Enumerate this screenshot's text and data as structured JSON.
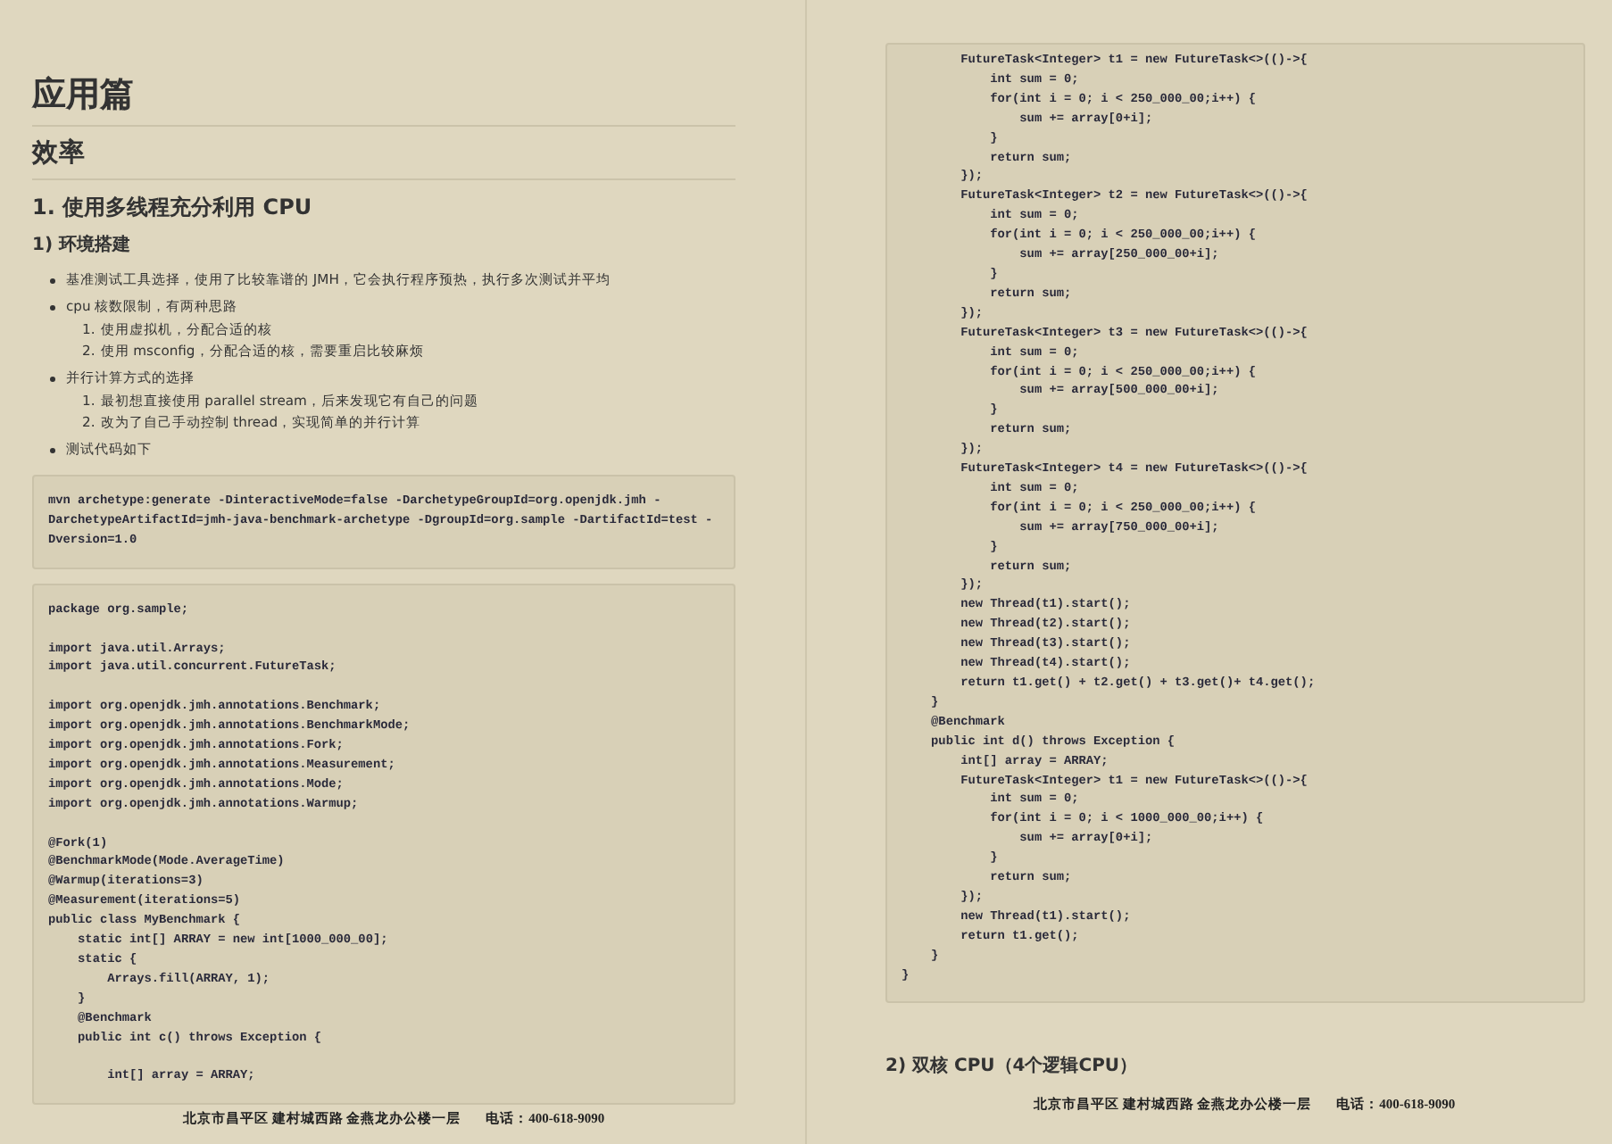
{
  "pages": [
    {
      "blocks": [
        {
          "kind": "h1",
          "text": "应用篇"
        },
        {
          "kind": "h2",
          "text": "效率"
        },
        {
          "kind": "h3",
          "text": "1. 使用多线程充分利用 CPU"
        },
        {
          "kind": "h4",
          "text": "1) 环境搭建"
        },
        {
          "kind": "bullets",
          "items": [
            {
              "text": "基准测试工具选择，使用了比较靠谱的 JMH，它会执行程序预热，执行多次测试并平均"
            },
            {
              "text": "cpu 核数限制，有两种思路",
              "children": [
                {
                  "number": "1.",
                  "text": "使用虚拟机，分配合适的核"
                },
                {
                  "number": "2.",
                  "text": "使用 msconfig，分配合适的核，需要重启比较麻烦"
                }
              ]
            },
            {
              "text": "并行计算方式的选择",
              "children": [
                {
                  "number": "1.",
                  "text": "最初想直接使用 parallel stream，后来发现它有自己的问题"
                },
                {
                  "number": "2.",
                  "text": "改为了自己手动控制 thread，实现简单的并行计算"
                }
              ]
            },
            {
              "text": "测试代码如下"
            }
          ]
        },
        {
          "kind": "code",
          "lines": [
            {
              "text": "mvn archetype:generate -DinteractiveMode=false -DarchetypeGroupId=org.openjdk.jmh -DarchetypeArtifactId=jmh-java-benchmark-archetype -DgroupId=org.sample -DartifactId=test -Dversion=1.0"
            }
          ]
        },
        {
          "kind": "code",
          "lines": [
            {
              "text": "package org.sample;"
            },
            {
              "text": "import java.util.Arrays;",
              "blank_before": true
            },
            {
              "text": "import java.util.concurrent.FutureTask;"
            },
            {
              "text": "import org.openjdk.jmh.annotations.Benchmark;",
              "blank_before": true
            },
            {
              "text": "import org.openjdk.jmh.annotations.BenchmarkMode;"
            },
            {
              "text": "import org.openjdk.jmh.annotations.Fork;"
            },
            {
              "text": "import org.openjdk.jmh.annotations.Measurement;"
            },
            {
              "text": "import org.openjdk.jmh.annotations.Mode;"
            },
            {
              "text": "import org.openjdk.jmh.annotations.Warmup;"
            },
            {
              "text": "@Fork(1)",
              "blank_before": true
            },
            {
              "text": "@BenchmarkMode(Mode.AverageTime)"
            },
            {
              "text": "@Warmup(iterations=3)"
            },
            {
              "text": "@Measurement(iterations=5)"
            },
            {
              "text": "public class MyBenchmark {"
            },
            {
              "text": "    static int[] ARRAY = new int[1000_000_00];"
            },
            {
              "text": "    static {"
            },
            {
              "text": "        Arrays.fill(ARRAY, 1);"
            },
            {
              "text": "    }"
            },
            {
              "text": "    @Benchmark"
            },
            {
              "text": "    public int c() throws Exception {"
            },
            {
              "text": "        int[] array = ARRAY;",
              "blank_before": true
            }
          ]
        }
      ],
      "footer": {
        "address": "北京市昌平区 建村城西路 金燕龙办公楼一层",
        "phone": "电话：400-618-9090"
      }
    },
    {
      "blocks": [
        {
          "kind": "code",
          "lines": [
            {
              "text": "        FutureTask<Integer> t1 = new FutureTask<>(()->{"
            },
            {
              "text": "            int sum = 0;"
            },
            {
              "text": "            for(int i = 0; i < 250_000_00;i++) {"
            },
            {
              "text": "                sum += array[0+i];"
            },
            {
              "text": "            }"
            },
            {
              "text": "            return sum;"
            },
            {
              "text": "        });"
            },
            {
              "text": "        FutureTask<Integer> t2 = new FutureTask<>(()->{"
            },
            {
              "text": "            int sum = 0;"
            },
            {
              "text": "            for(int i = 0; i < 250_000_00;i++) {"
            },
            {
              "text": "                sum += array[250_000_00+i];"
            },
            {
              "text": "            }"
            },
            {
              "text": "            return sum;"
            },
            {
              "text": "        });"
            },
            {
              "text": "        FutureTask<Integer> t3 = new FutureTask<>(()->{"
            },
            {
              "text": "            int sum = 0;"
            },
            {
              "text": "            for(int i = 0; i < 250_000_00;i++) {"
            },
            {
              "text": "                sum += array[500_000_00+i];"
            },
            {
              "text": "            }"
            },
            {
              "text": "            return sum;"
            },
            {
              "text": "        });"
            },
            {
              "text": "        FutureTask<Integer> t4 = new FutureTask<>(()->{"
            },
            {
              "text": "            int sum = 0;"
            },
            {
              "text": "            for(int i = 0; i < 250_000_00;i++) {"
            },
            {
              "text": "                sum += array[750_000_00+i];"
            },
            {
              "text": "            }"
            },
            {
              "text": "            return sum;"
            },
            {
              "text": "        });"
            },
            {
              "text": "        new Thread(t1).start();"
            },
            {
              "text": "        new Thread(t2).start();"
            },
            {
              "text": "        new Thread(t3).start();"
            },
            {
              "text": "        new Thread(t4).start();"
            },
            {
              "text": "        return t1.get() + t2.get() + t3.get()+ t4.get();"
            },
            {
              "text": "    }"
            },
            {
              "text": "    @Benchmark"
            },
            {
              "text": "    public int d() throws Exception {"
            },
            {
              "text": "        int[] array = ARRAY;"
            },
            {
              "text": "        FutureTask<Integer> t1 = new FutureTask<>(()->{"
            },
            {
              "text": "            int sum = 0;"
            },
            {
              "text": "            for(int i = 0; i < 1000_000_00;i++) {"
            },
            {
              "text": "                sum += array[0+i];"
            },
            {
              "text": "            }"
            },
            {
              "text": "            return sum;"
            },
            {
              "text": "        });"
            },
            {
              "text": "        new Thread(t1).start();"
            },
            {
              "text": "        return t1.get();"
            },
            {
              "text": "    }"
            },
            {
              "text": "}"
            }
          ]
        },
        {
          "kind": "h4",
          "text": "2) 双核 CPU（4个逻辑CPU）"
        }
      ],
      "footer": {
        "address": "北京市昌平区 建村城西路 金燕龙办公楼一层",
        "phone": "电话：400-618-9090"
      }
    }
  ]
}
